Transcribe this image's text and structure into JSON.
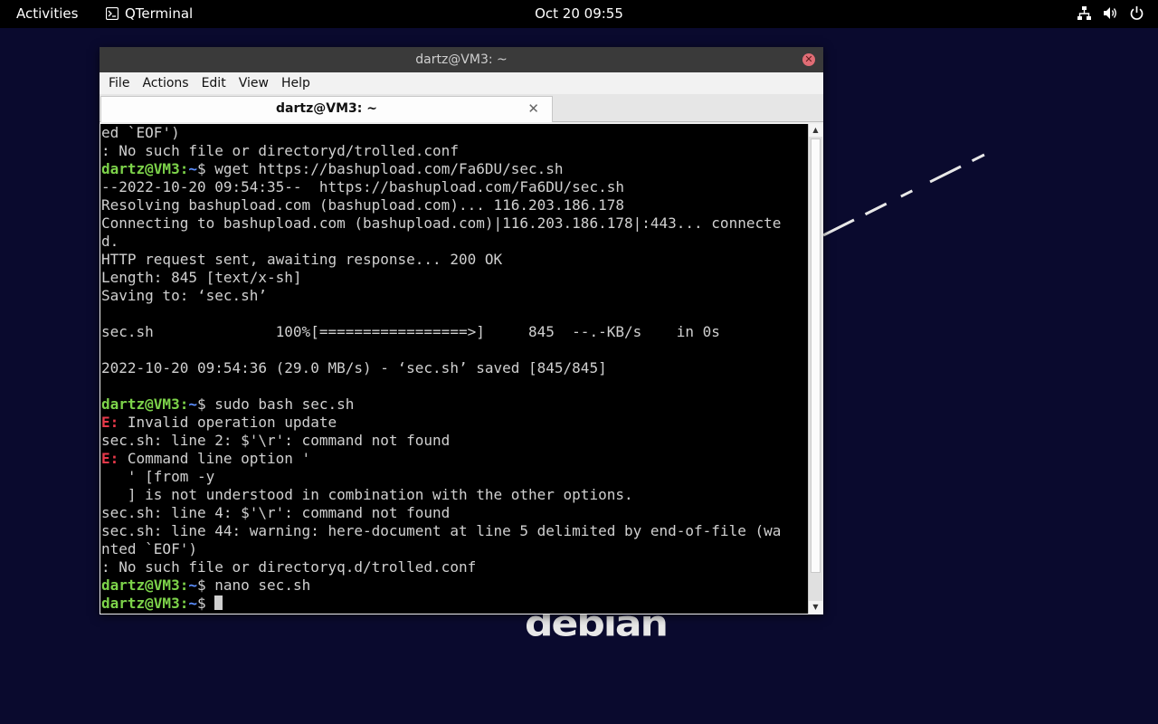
{
  "topbar": {
    "activities": "Activities",
    "app_name": "QTerminal",
    "clock": "Oct 20  09:55",
    "tray_icons": [
      "network-icon",
      "volume-icon",
      "power-icon"
    ]
  },
  "desktop": {
    "logo_text": "debian"
  },
  "window": {
    "title": "dartz@VM3: ~",
    "menu": [
      "File",
      "Actions",
      "Edit",
      "View",
      "Help"
    ],
    "tab_label": "dartz@VM3: ~",
    "tab_close": "✕"
  },
  "terminal": {
    "prompt_user": "dartz@VM3",
    "prompt_sep": ":",
    "prompt_path": "~",
    "prompt_end": "$ ",
    "lines": [
      {
        "kind": "text",
        "text": "ed `EOF')"
      },
      {
        "kind": "text",
        "text": ": No such file or directoryd/trolled.conf"
      },
      {
        "kind": "prompt",
        "cmd": "wget https://bashupload.com/Fa6DU/sec.sh"
      },
      {
        "kind": "text",
        "text": "--2022-10-20 09:54:35--  https://bashupload.com/Fa6DU/sec.sh"
      },
      {
        "kind": "text",
        "text": "Resolving bashupload.com (bashupload.com)... 116.203.186.178"
      },
      {
        "kind": "text",
        "text": "Connecting to bashupload.com (bashupload.com)|116.203.186.178|:443... connecte"
      },
      {
        "kind": "text",
        "text": "d."
      },
      {
        "kind": "text",
        "text": "HTTP request sent, awaiting response... 200 OK"
      },
      {
        "kind": "text",
        "text": "Length: 845 [text/x-sh]"
      },
      {
        "kind": "text",
        "text": "Saving to: ‘sec.sh’"
      },
      {
        "kind": "text",
        "text": ""
      },
      {
        "kind": "text",
        "text": "sec.sh              100%[=================>]     845  --.-KB/s    in 0s"
      },
      {
        "kind": "text",
        "text": ""
      },
      {
        "kind": "text",
        "text": "2022-10-20 09:54:36 (29.0 MB/s) - ‘sec.sh’ saved [845/845]"
      },
      {
        "kind": "text",
        "text": ""
      },
      {
        "kind": "prompt",
        "cmd": "sudo bash sec.sh"
      },
      {
        "kind": "error",
        "tag": "E:",
        "text": " Invalid operation update"
      },
      {
        "kind": "text",
        "text": "sec.sh: line 2: $'\\r': command not found"
      },
      {
        "kind": "error",
        "tag": "E:",
        "text": " Command line option '"
      },
      {
        "kind": "text",
        "text": "   ' [from -y"
      },
      {
        "kind": "text",
        "text": "   ] is not understood in combination with the other options."
      },
      {
        "kind": "text",
        "text": "sec.sh: line 4: $'\\r': command not found"
      },
      {
        "kind": "text",
        "text": "sec.sh: line 44: warning: here-document at line 5 delimited by end-of-file (wa"
      },
      {
        "kind": "text",
        "text": "nted `EOF')"
      },
      {
        "kind": "text",
        "text": ": No such file or directoryq.d/trolled.conf"
      },
      {
        "kind": "prompt",
        "cmd": "nano sec.sh"
      },
      {
        "kind": "prompt",
        "cmd": "",
        "cursor": true
      }
    ]
  }
}
